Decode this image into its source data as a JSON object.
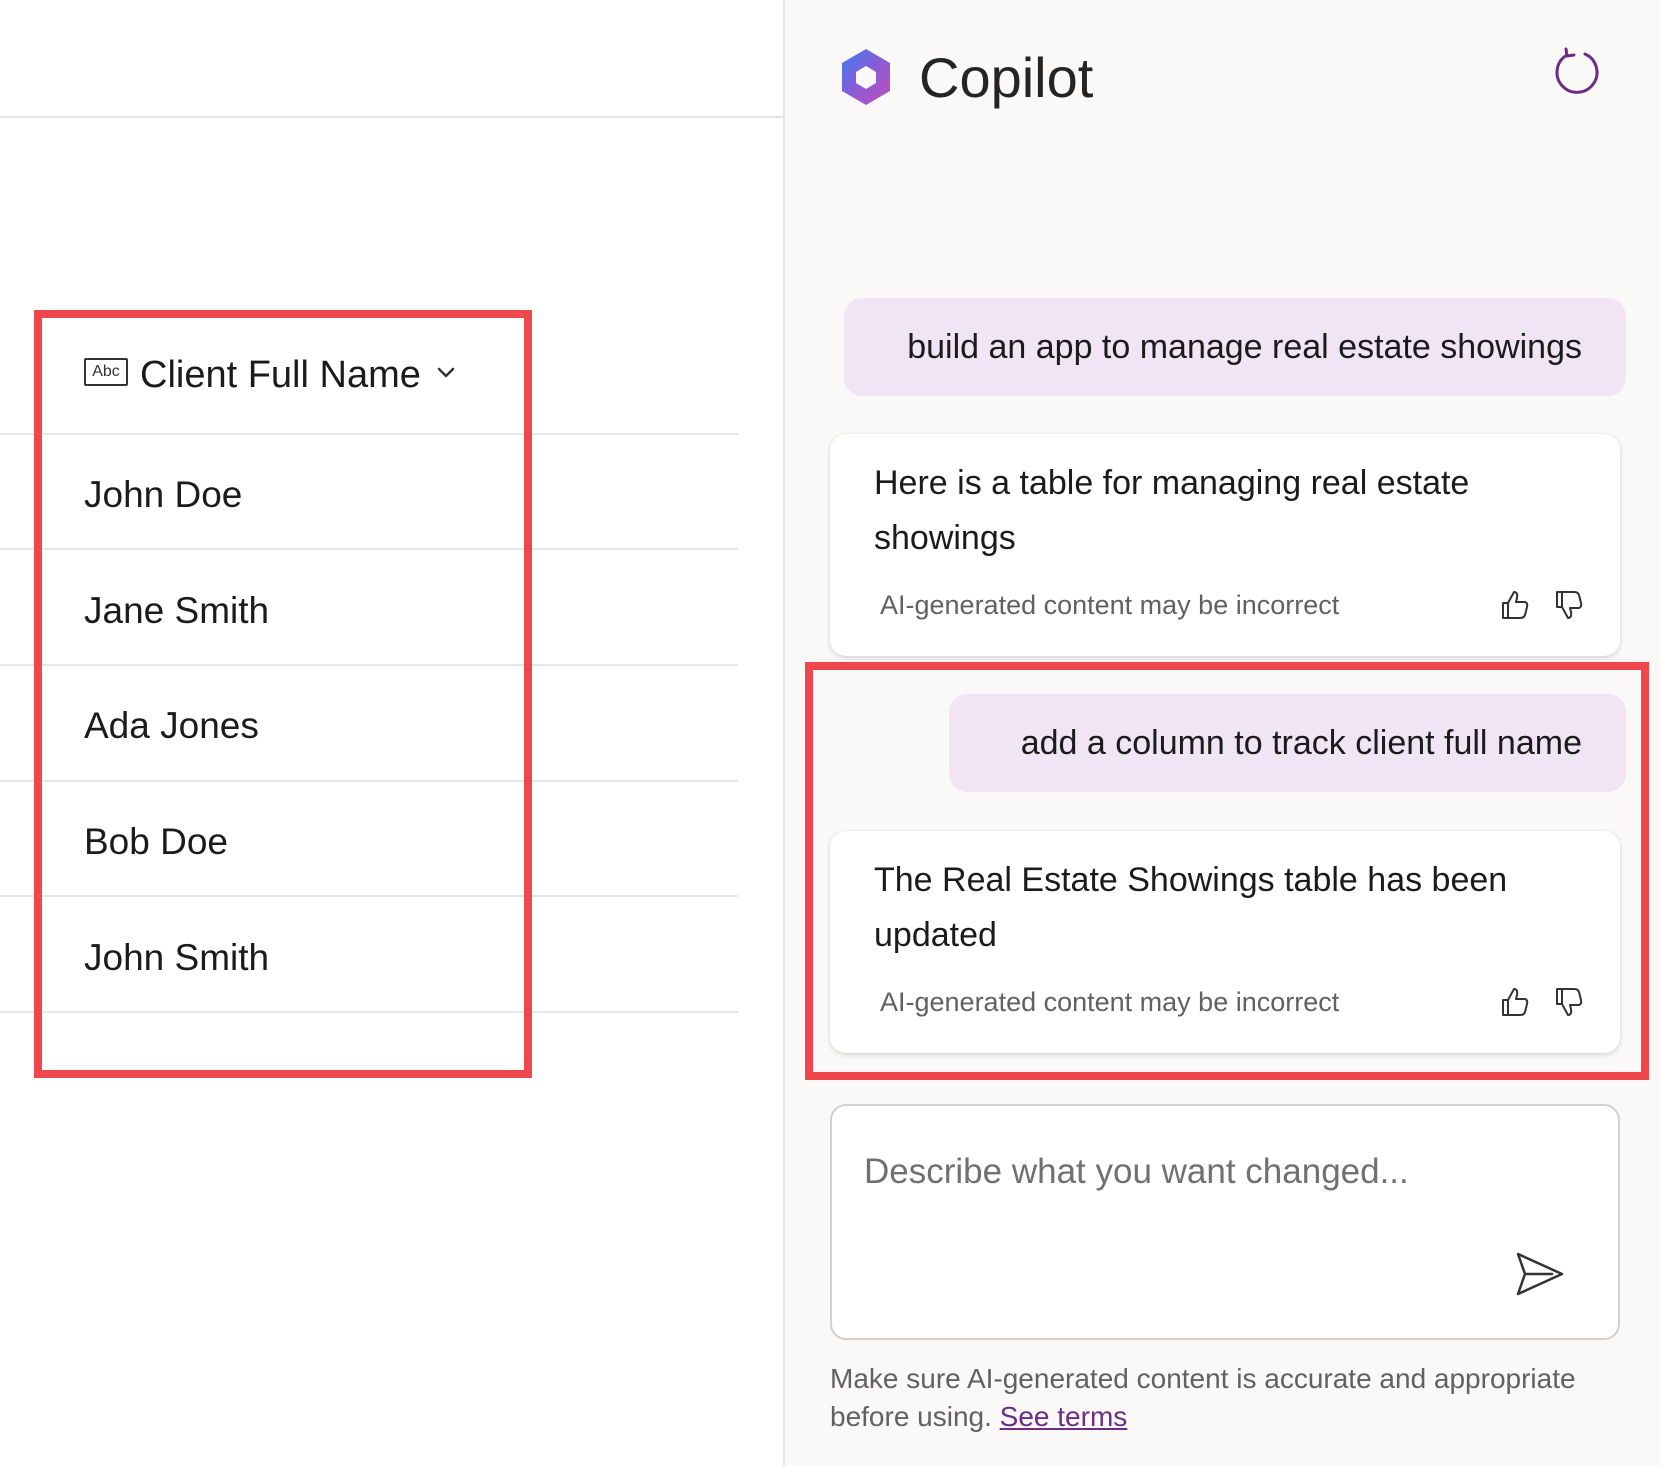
{
  "table": {
    "column": {
      "type_badge": "Abc",
      "title": "Client Full Name"
    },
    "rows": [
      "John Doe",
      "Jane Smith",
      "Ada Jones",
      "Bob Doe",
      "John Smith"
    ]
  },
  "copilot": {
    "title": "Copilot",
    "messages": [
      {
        "role": "user",
        "text": "build an app to manage real estate showings"
      },
      {
        "role": "assistant",
        "text": "Here is a table for managing real estate showings",
        "disclaimer": "AI-generated content may be incorrect"
      },
      {
        "role": "user",
        "text": "add a column to track client full name"
      },
      {
        "role": "assistant",
        "text": "The Real Estate Showings table has been updated",
        "disclaimer": "AI-generated content may be incorrect"
      }
    ],
    "composer": {
      "placeholder": "Describe what you want changed..."
    },
    "footnote": {
      "text": "Make sure AI-generated content is accurate and appropriate before using.",
      "link": "See terms"
    }
  },
  "colors": {
    "highlight": "#f0474c",
    "user_bubble": "#f1e4f5",
    "link": "#6b2d86",
    "accent": "#7a3d91"
  }
}
